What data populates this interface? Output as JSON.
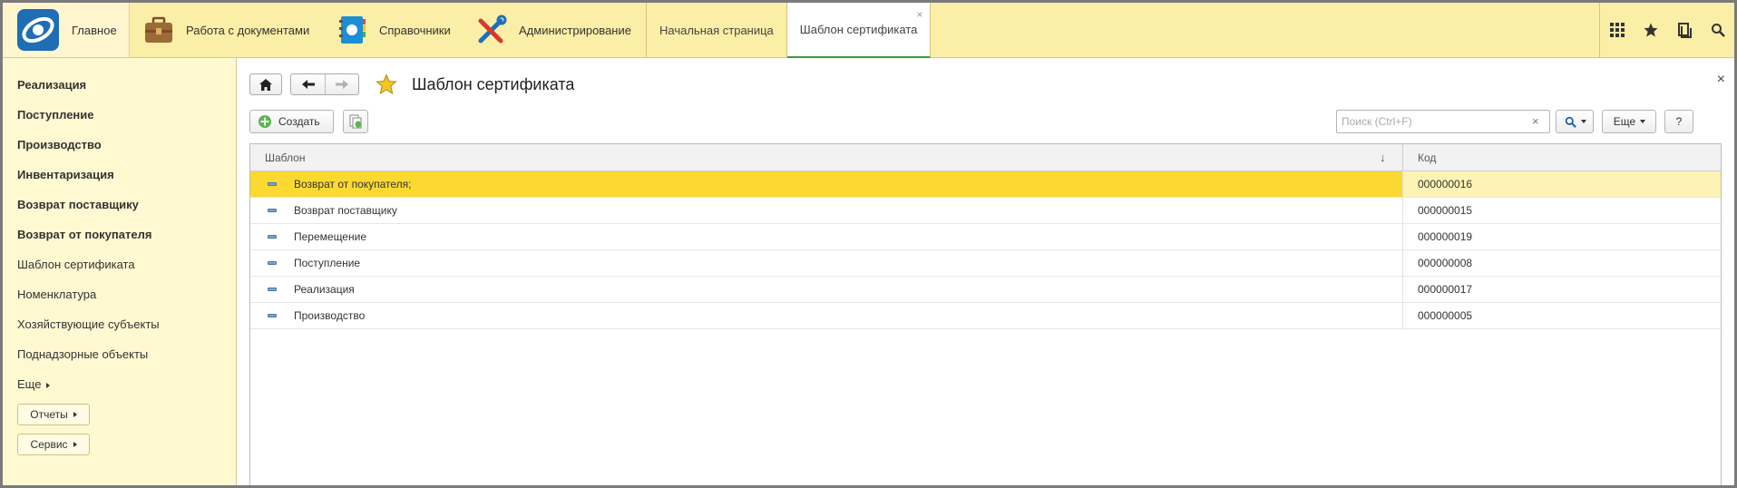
{
  "sections": {
    "main": "Главное",
    "documents": "Работа с документами",
    "references": "Справочники",
    "administration": "Администрирование"
  },
  "open_tabs": {
    "home": "Начальная страница",
    "current": "Шаблон сертификата",
    "close_symbol": "×"
  },
  "sidebar": {
    "items": [
      "Реализация",
      "Поступление",
      "Производство",
      "Инвентаризация",
      "Возврат поставщику",
      "Возврат от покупателя",
      "Шаблон сертификата",
      "Номенклатура",
      "Хозяйствующие субъекты",
      "Поднадзорные объекты",
      "Еще"
    ],
    "reports_label": "Отчеты",
    "service_label": "Сервис"
  },
  "form": {
    "title": "Шаблон сертификата",
    "close_symbol": "×",
    "create_label": "Создать",
    "search_placeholder": "Поиск (Ctrl+F)",
    "search_clear": "×",
    "more_label": "Еще",
    "help_label": "?"
  },
  "table": {
    "col_template": "Шаблон",
    "col_code": "Код",
    "sort_indicator": "↓",
    "rows": [
      {
        "name": "Возврат от покупателя;",
        "code": "000000016"
      },
      {
        "name": "Возврат поставщику",
        "code": "000000015"
      },
      {
        "name": "Перемещение",
        "code": "000000019"
      },
      {
        "name": "Поступление",
        "code": "000000008"
      },
      {
        "name": "Реализация",
        "code": "000000017"
      },
      {
        "name": "Производство",
        "code": "000000005"
      }
    ]
  },
  "colors": {
    "panel_yellow": "#fbeea6",
    "selection": "#fcd931",
    "active_tab_underline": "#3c9a3c"
  },
  "icons": {
    "logo": "app-logo-icon",
    "documents": "briefcase-icon",
    "references": "address-book-icon",
    "administration": "tools-icon",
    "apps": "grid-icon",
    "favorites": "star-icon",
    "history": "history-icon",
    "search": "search-icon"
  }
}
